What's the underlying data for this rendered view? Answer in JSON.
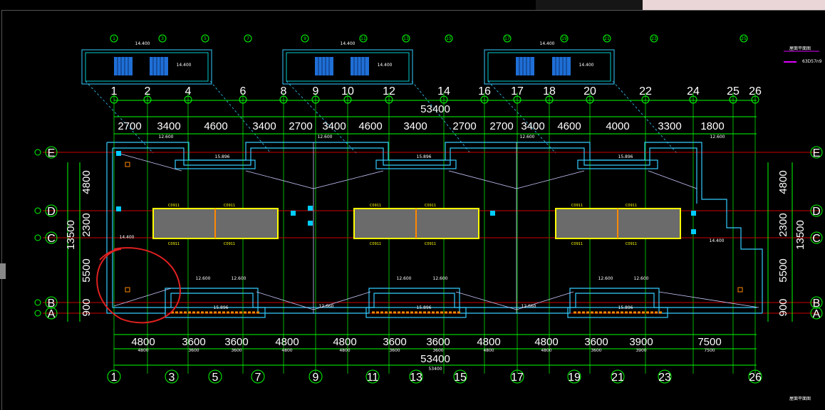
{
  "ribbon": {
    "text": ""
  },
  "columns_top": [
    "1",
    "2",
    "4",
    "6",
    "8",
    "9",
    "10",
    "12",
    "14",
    "16",
    "17",
    "18",
    "20",
    "22",
    "24",
    "25",
    "26"
  ],
  "columns_bottom": [
    "1",
    "3",
    "5",
    "7",
    "9",
    "11",
    "13",
    "15",
    "17",
    "19",
    "21",
    "23",
    "26"
  ],
  "bubbles_top": [
    "1",
    "3",
    "5",
    "7",
    "9",
    "11",
    "13",
    "15",
    "17",
    "19",
    "21",
    "23",
    "25"
  ],
  "rows_left": [
    "E",
    "D",
    "C",
    "B",
    "A"
  ],
  "rows_right": [
    "E",
    "D",
    "C",
    "B",
    "A"
  ],
  "overall_top": "53400",
  "overall_bottom": "53400",
  "overall_bottom_small": "53400",
  "dims_top": [
    "2700",
    "3400",
    "4600",
    "3400",
    "2700",
    "3400",
    "4600",
    "3400",
    "2700",
    "2700",
    "3400",
    "4600",
    "4000",
    "3300",
    "1800"
  ],
  "dims_bottom": [
    "4800",
    "3600",
    "3600",
    "4800",
    "4800",
    "3600",
    "3600",
    "4800",
    "4800",
    "3600",
    "3900",
    "7500"
  ],
  "dims_bottom_small": [
    "4800",
    "3600",
    "3600",
    "4800",
    "4800",
    "3600",
    "3600",
    "4800",
    "4800",
    "3600",
    "3900",
    "7500"
  ],
  "dims_left_big": [
    "4800",
    "2300",
    "5500",
    "900"
  ],
  "dims_left_total": "13500",
  "dims_right_big": [
    "4800",
    "2300",
    "5500",
    "900"
  ],
  "dims_right_total": "13500",
  "elev_labels": [
    "14.400",
    "12.600",
    "15.896",
    "12.660",
    "C0911"
  ],
  "side_panel": {
    "label1": "屋面平面图",
    "label2": "63D57n9",
    "label3": "屋面平面图"
  },
  "annotation": {
    "color": "#e02020"
  }
}
